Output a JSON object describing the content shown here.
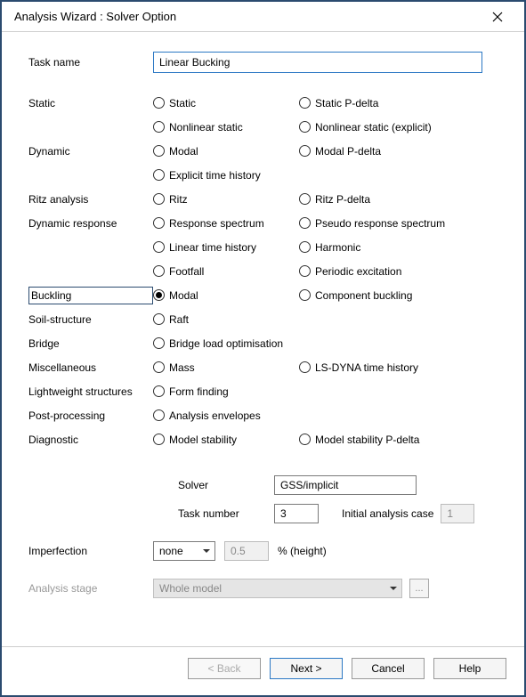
{
  "window": {
    "title": "Analysis Wizard : Solver Option"
  },
  "taskname": {
    "label": "Task name",
    "value": "Linear Bucking"
  },
  "groups": {
    "static": "Static",
    "dynamic": "Dynamic",
    "ritz": "Ritz analysis",
    "dynresp": "Dynamic response",
    "buckling": "Buckling",
    "soil": "Soil-structure",
    "bridge": "Bridge",
    "misc": "Miscellaneous",
    "lightweight": "Lightweight structures",
    "postproc": "Post-processing",
    "diag": "Diagnostic"
  },
  "options": {
    "static1": "Static",
    "static2": "Static P-delta",
    "nlstatic1": "Nonlinear static",
    "nlstatic2": "Nonlinear static (explicit)",
    "modal1": "Modal",
    "modal2": "Modal P-delta",
    "explth": "Explicit time history",
    "ritz1": "Ritz",
    "ritz2": "Ritz P-delta",
    "respspec": "Response spectrum",
    "psrespspec": "Pseudo response spectrum",
    "linth": "Linear time history",
    "harmonic": "Harmonic",
    "footfall": "Footfall",
    "periodic": "Periodic excitation",
    "buckmodal": "Modal",
    "compbuck": "Component buckling",
    "raft": "Raft",
    "bridgeopt": "Bridge load optimisation",
    "mass": "Mass",
    "lsdyna": "LS-DYNA time history",
    "formfind": "Form finding",
    "envelopes": "Analysis envelopes",
    "modstab": "Model stability",
    "modstabpd": "Model stability P-delta"
  },
  "solver": {
    "label": "Solver",
    "value": "GSS/implicit"
  },
  "tasknum": {
    "label": "Task number",
    "value": "3"
  },
  "initcase": {
    "label": "Initial analysis case",
    "value": "1"
  },
  "imperf": {
    "label": "Imperfection",
    "select": "none",
    "val": "0.5",
    "suffix": "% (height)"
  },
  "stage": {
    "label": "Analysis stage",
    "value": "Whole model"
  },
  "buttons": {
    "back": "< Back",
    "next": "Next >",
    "cancel": "Cancel",
    "help": "Help"
  }
}
